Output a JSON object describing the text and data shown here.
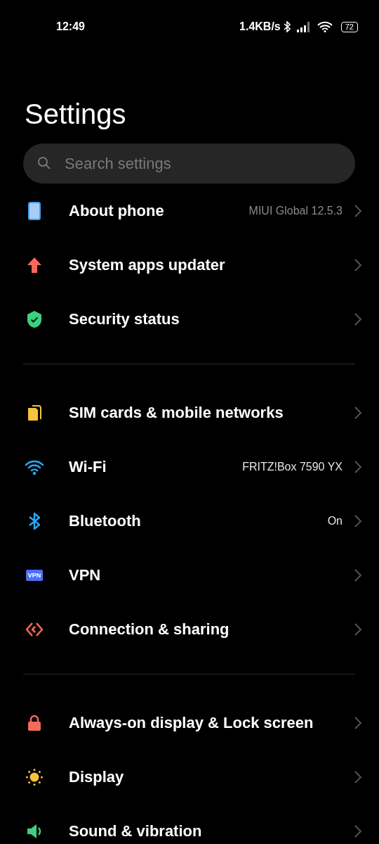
{
  "status_bar": {
    "time": "12:49",
    "speed": "1.4KB/s",
    "battery": "72"
  },
  "title": "Settings",
  "search": {
    "placeholder": "Search settings"
  },
  "groups": [
    {
      "items": [
        {
          "label": "About phone",
          "value": "MIUI Global 12.5.3",
          "value_dim": true
        },
        {
          "label": "System apps updater"
        },
        {
          "label": "Security status"
        }
      ]
    },
    {
      "items": [
        {
          "label": "SIM cards & mobile networks"
        },
        {
          "label": "Wi-Fi",
          "value": "FRITZ!Box 7590 YX",
          "value_dim": false
        },
        {
          "label": "Bluetooth",
          "value": "On",
          "value_dim": false
        },
        {
          "label": "VPN",
          "vpn_text": "VPN"
        },
        {
          "label": "Connection & sharing"
        }
      ]
    },
    {
      "items": [
        {
          "label": "Always-on display & Lock screen"
        },
        {
          "label": "Display"
        },
        {
          "label": "Sound & vibration"
        }
      ]
    }
  ]
}
